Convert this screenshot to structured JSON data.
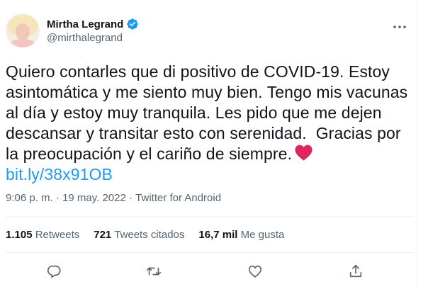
{
  "user": {
    "display_name": "Mirtha Legrand",
    "handle": "@mirthalegrand",
    "verified": true
  },
  "tweet": {
    "text": "Quiero contarles que di positivo de COVID-19. Estoy asintomática y me siento muy bien. Tengo mis vacunas al día y estoy muy tranquila. Les pido que me dejen descansar y transitar esto con serenidad.  Gracias por la preocupación y el cariño de siempre.",
    "link": "bit.ly/38x91OB"
  },
  "meta": {
    "time": "9:06 p. m.",
    "separator": "·",
    "date": "19 may. 2022",
    "source": "Twitter for Android"
  },
  "stats": {
    "retweets_count": "1.105",
    "retweets_label": "Retweets",
    "quotes_count": "721",
    "quotes_label": "Tweets citados",
    "likes_count": "16,7 mil",
    "likes_label": "Me gusta"
  },
  "colors": {
    "accent": "#1d9bf0",
    "heart": "#e0245e",
    "muted": "#536471",
    "divider": "#eff3f4"
  },
  "icons": [
    "verified-badge-icon",
    "more-options-icon",
    "red-heart-emoji",
    "reply-icon",
    "retweet-icon",
    "like-icon",
    "share-icon"
  ]
}
